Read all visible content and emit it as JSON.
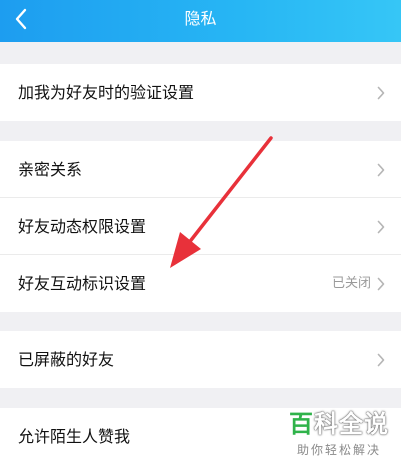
{
  "header": {
    "title": "隐私",
    "back_icon": "chevron-left-icon"
  },
  "groups": [
    {
      "items": [
        {
          "label": "加我为好友时的验证设置"
        }
      ]
    },
    {
      "items": [
        {
          "label": "亲密关系"
        },
        {
          "label": "好友动态权限设置"
        },
        {
          "label": "好友互动标识设置",
          "value": "已关闭"
        }
      ]
    },
    {
      "items": [
        {
          "label": "已屏蔽的好友"
        }
      ]
    },
    {
      "items": [
        {
          "label": "允许陌生人赞我"
        }
      ]
    }
  ],
  "watermark": {
    "logo_a": "百",
    "logo_b": "科全说",
    "subtitle": "助你轻松解决"
  },
  "colors": {
    "header": "#27b6f4",
    "arrow": "#e8313a",
    "accent": "#2fb34a"
  }
}
